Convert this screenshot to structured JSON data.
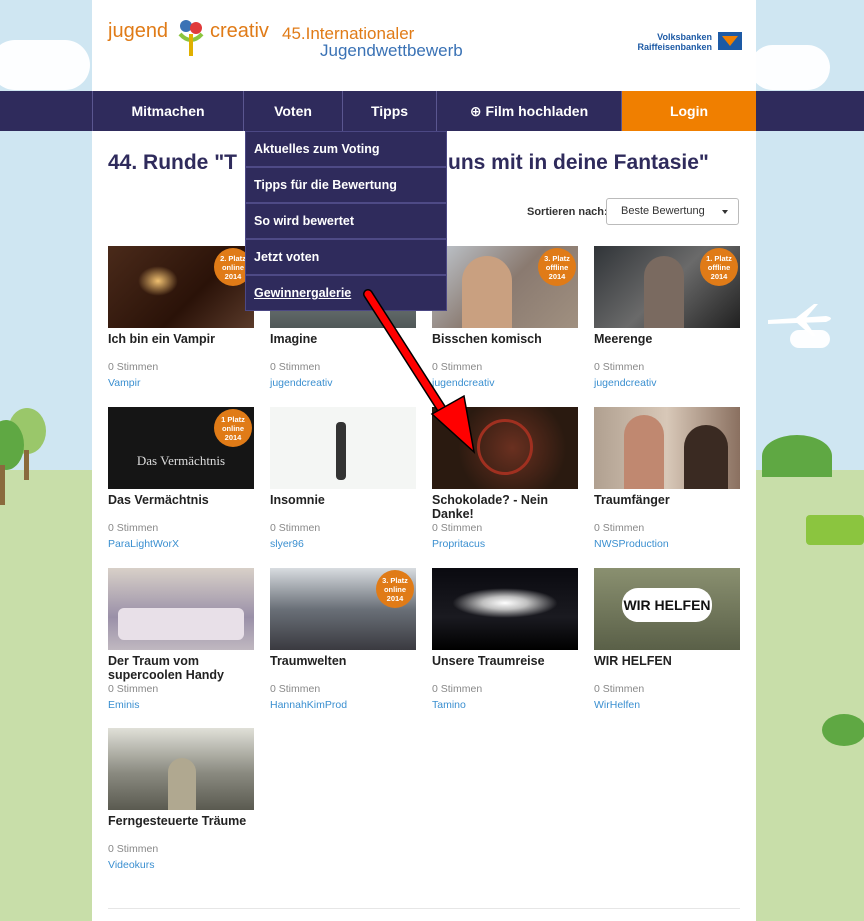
{
  "header": {
    "logo_part1": "jugend",
    "logo_part2": "creativ",
    "competition_line1": "45.Internationaler",
    "competition_line2": "Jugendwettbewerb",
    "bank_line1": "Volksbanken",
    "bank_line2": "Raiffeisenbanken"
  },
  "nav": {
    "items": [
      {
        "label": "Mitmachen"
      },
      {
        "label": "Voten"
      },
      {
        "label": "Tipps"
      },
      {
        "label": "⊕ Film hochladen"
      },
      {
        "label": "Login"
      }
    ]
  },
  "dropdown": {
    "items": [
      {
        "label": "Aktuelles zum Voting"
      },
      {
        "label": "Tipps für die Bewertung"
      },
      {
        "label": "So wird bewertet"
      },
      {
        "label": "Jetzt voten"
      },
      {
        "label": "Gewinnergalerie"
      }
    ]
  },
  "main": {
    "title_left": "44. Runde \"T",
    "title_right": "uns mit in deine Fantasie\"",
    "sort_label": "Sortieren nach:",
    "sort_value": "Beste Bewertung"
  },
  "videos": [
    {
      "title": "Ich bin ein Vampir",
      "votes": "0 Stimmen",
      "author": "Vampir",
      "badge": [
        "2. Platz",
        "online",
        "2014"
      ]
    },
    {
      "title": "Imagine",
      "votes": "0 Stimmen",
      "author": "jugendcreativ",
      "badge": null
    },
    {
      "title": "Bisschen komisch",
      "votes": "0 Stimmen",
      "author": "jugendcreativ",
      "badge": [
        "3. Platz",
        "offline",
        "2014"
      ]
    },
    {
      "title": "Meerenge",
      "votes": "0 Stimmen",
      "author": "jugendcreativ",
      "badge": [
        "1. Platz",
        "offline",
        "2014"
      ]
    },
    {
      "title": "Das Vermächtnis",
      "votes": "0 Stimmen",
      "author": "ParaLightWorX",
      "badge": [
        "1 Platz",
        "online",
        "2014"
      ],
      "overlay": "Das Vermächtnis"
    },
    {
      "title": "Insomnie",
      "votes": "0 Stimmen",
      "author": "slyer96",
      "badge": null
    },
    {
      "title": "Schokolade? - Nein Danke!",
      "votes": "0 Stimmen",
      "author": "Propritacus",
      "badge": null
    },
    {
      "title": "Traumfänger",
      "votes": "0 Stimmen",
      "author": "NWSProduction",
      "badge": null
    },
    {
      "title": "Der Traum vom supercoolen Handy",
      "votes": "0 Stimmen",
      "author": "Eminis",
      "badge": null
    },
    {
      "title": "Traumwelten",
      "votes": "0 Stimmen",
      "author": "HannahKimProd",
      "badge": [
        "3. Platz",
        "online",
        "2014"
      ]
    },
    {
      "title": "Unsere Traumreise",
      "votes": "0 Stimmen",
      "author": "Tamino",
      "badge": null
    },
    {
      "title": "WIR HELFEN",
      "votes": "0 Stimmen",
      "author": "WirHelfen",
      "badge": null,
      "overlay": "WIR HELFEN"
    },
    {
      "title": "Ferngesteuerte Träume",
      "votes": "0 Stimmen",
      "author": "Videokurs",
      "badge": null
    }
  ],
  "colors": {
    "nav_bg": "#2f2b5c",
    "login_bg": "#f07f00",
    "badge_bg": "#e07b17",
    "author_link": "#3a8fd0",
    "arrow": "#ff0000"
  }
}
